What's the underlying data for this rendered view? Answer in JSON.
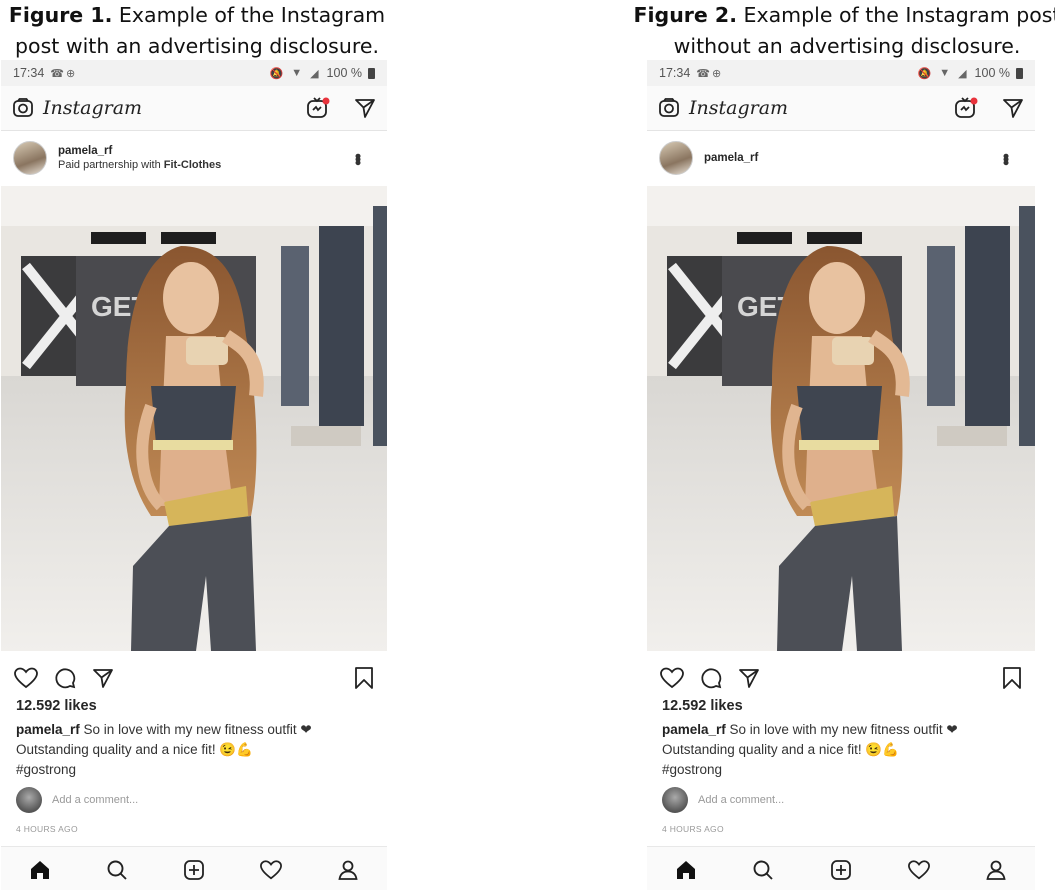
{
  "figures": [
    {
      "caption_bold": "Figure 1.",
      "caption_line1": " Example of the Instagram",
      "caption_line2": "post with an advertising disclosure.",
      "status": {
        "time": "17:34",
        "battery": "100 %"
      },
      "app_name": "Instagram",
      "post": {
        "username": "pamela_rf",
        "partnership_prefix": "Paid partnership with ",
        "partnership_brand": "Fit-Clothes",
        "likes": "12.592 likes",
        "caption_user": "pamela_rf",
        "caption_line1": " So in love with my new fitness outfit ❤",
        "caption_line2": "Outstanding quality and a nice fit! 😉💪",
        "caption_line3": "#gostrong",
        "comment_placeholder": "Add a comment...",
        "time_ago": "4 HOURS AGO"
      }
    },
    {
      "caption_bold": "Figure 2.",
      "caption_line1": " Example of the Instagram post",
      "caption_line2": "without an advertising disclosure.",
      "status": {
        "time": "17:34",
        "battery": "100 %"
      },
      "app_name": "Instagram",
      "post": {
        "username": "pamela_rf",
        "likes": "12.592 likes",
        "caption_user": "pamela_rf",
        "caption_line1": " So in love with my new fitness outfit ❤",
        "caption_line2": "Outstanding quality and a nice fit! 😉💪",
        "caption_line3": "#gostrong",
        "comment_placeholder": "Add a comment...",
        "time_ago": "4 HOURS AGO"
      }
    }
  ],
  "icons": {
    "status_left": [
      "whatsapp-icon",
      "add-circle-icon"
    ],
    "status_right": [
      "mute-icon",
      "wifi-icon",
      "signal-icon",
      "battery-icon"
    ],
    "header": [
      "camera-icon",
      "igtv-icon",
      "direct-message-icon"
    ],
    "actions": [
      "heart-icon",
      "comment-icon",
      "share-icon",
      "bookmark-icon"
    ],
    "navbar": [
      "home-icon",
      "search-icon",
      "new-post-icon",
      "activity-icon",
      "profile-icon"
    ]
  },
  "colors": {
    "notification_dot": "#e8333c",
    "heart_emoji": "#e0242f"
  }
}
